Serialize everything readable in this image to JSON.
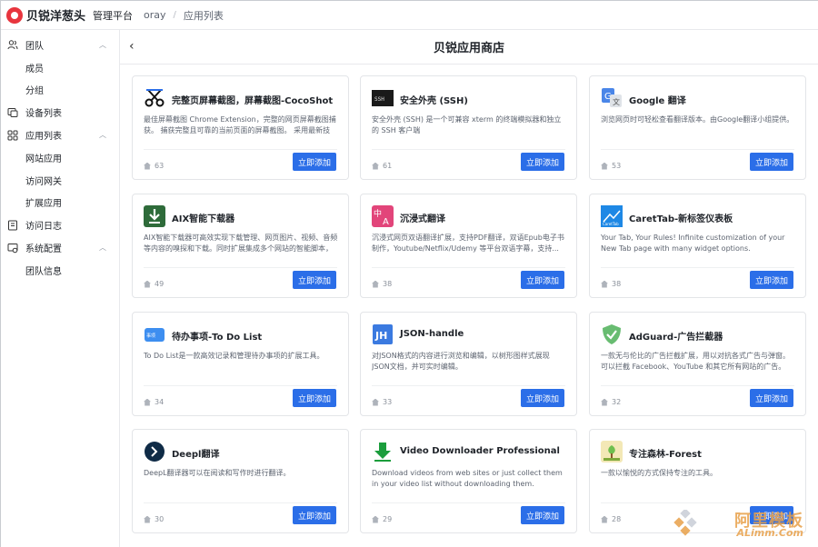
{
  "topbar": {
    "brand_name": "贝锐洋葱头",
    "brand_sub": "管理平台",
    "crumbs": [
      "oray",
      "应用列表"
    ],
    "crumb_sep": "/"
  },
  "sidebar": {
    "items": [
      {
        "type": "group",
        "label": "团队",
        "icon": "team-icon",
        "expanded": true
      },
      {
        "type": "sub",
        "label": "成员"
      },
      {
        "type": "sub",
        "label": "分组"
      },
      {
        "type": "group",
        "label": "设备列表",
        "icon": "device-icon"
      },
      {
        "type": "group",
        "label": "应用列表",
        "icon": "apps-icon",
        "expanded": true
      },
      {
        "type": "sub",
        "label": "网站应用"
      },
      {
        "type": "sub",
        "label": "访问网关"
      },
      {
        "type": "sub",
        "label": "扩展应用"
      },
      {
        "type": "group",
        "label": "访问日志",
        "icon": "log-icon"
      },
      {
        "type": "group",
        "label": "系统配置",
        "icon": "settings-icon",
        "expanded": true
      },
      {
        "type": "sub",
        "label": "团队信息"
      }
    ]
  },
  "main": {
    "title": "贝锐应用商店",
    "back_icon": "chevron-left-icon"
  },
  "apps": [
    {
      "name": "完整页屏幕截图，屏幕截图-CocoShot",
      "desc": "最佳屏幕截图 Chrome Extension，完整的网页屏幕截图捕获。 捕获完整且可靠的当前页面的屏幕截图。 采用最新技术...",
      "count": "63",
      "button": "立即添加",
      "icon": "scissors-icon"
    },
    {
      "name": "安全外壳 (SSH)",
      "desc": "安全外壳 (SSH) 是一个可兼容 xterm 的终端模拟器和独立的 SSH 客户端",
      "count": "61",
      "button": "立即添加",
      "icon": "terminal-icon"
    },
    {
      "name": "Google 翻译",
      "desc": "浏览网页时可轻松查看翻译版本。由Google翻译小组提供。",
      "count": "53",
      "button": "立即添加",
      "icon": "translate-icon"
    },
    {
      "name": "AIX智能下载器",
      "desc": "AIX智能下载器可高效实现下载管理、网页图片、视频、音频等内容的嗅探和下载。同时扩展集成多个网站的智能脚本，快...",
      "count": "49",
      "button": "立即添加",
      "icon": "download-icon"
    },
    {
      "name": "沉浸式翻译",
      "desc": "沉浸式网页双语翻译扩展，支持PDF翻译，双语Epub电子书制作，Youtube/Netflix/Udemy 等平台双语字幕，支持...",
      "count": "38",
      "button": "立即添加",
      "icon": "immersive-translate-icon"
    },
    {
      "name": "CaretTab-新标签仪表板",
      "desc": "Your Tab, Your Rules! Infinite customization of your New Tab page with many widget options.",
      "count": "38",
      "button": "立即添加",
      "icon": "carettab-icon"
    },
    {
      "name": "待办事项-To Do List",
      "desc": "To Do List是一款高效记录和管理待办事项的扩展工具。",
      "count": "34",
      "button": "立即添加",
      "icon": "todo-icon"
    },
    {
      "name": "JSON-handle",
      "desc": "对JSON格式的内容进行浏览和编辑，以树形图样式展现JSON文档，并可实时编辑。",
      "count": "33",
      "button": "立即添加",
      "icon": "json-icon"
    },
    {
      "name": "AdGuard-广告拦截器",
      "desc": "一款无与伦比的广告拦截扩展，用以对抗各式广告与弹窗。可以拦截 Facebook、YouTube 和其它所有网站的广告。",
      "count": "32",
      "button": "立即添加",
      "icon": "shield-icon"
    },
    {
      "name": "Deepl翻译",
      "desc": "DeepL翻译器可以在阅读和写作时进行翻译。",
      "count": "30",
      "button": "立即添加",
      "icon": "deepl-icon"
    },
    {
      "name": "Video Downloader Professional",
      "desc": "Download videos from web sites or just collect them in your video list without downloading them.",
      "count": "29",
      "button": "立即添加",
      "icon": "arrow-down-icon"
    },
    {
      "name": "专注森林-Forest",
      "desc": "一款以愉悦的方式保持专注的工具。",
      "count": "28",
      "button": "立即添加",
      "icon": "forest-icon"
    }
  ],
  "watermark": {
    "top": "阿里模板",
    "bottom": "ALimm.Com"
  },
  "colors": {
    "primary": "#2b6ee8",
    "brand": "#e8353e"
  }
}
